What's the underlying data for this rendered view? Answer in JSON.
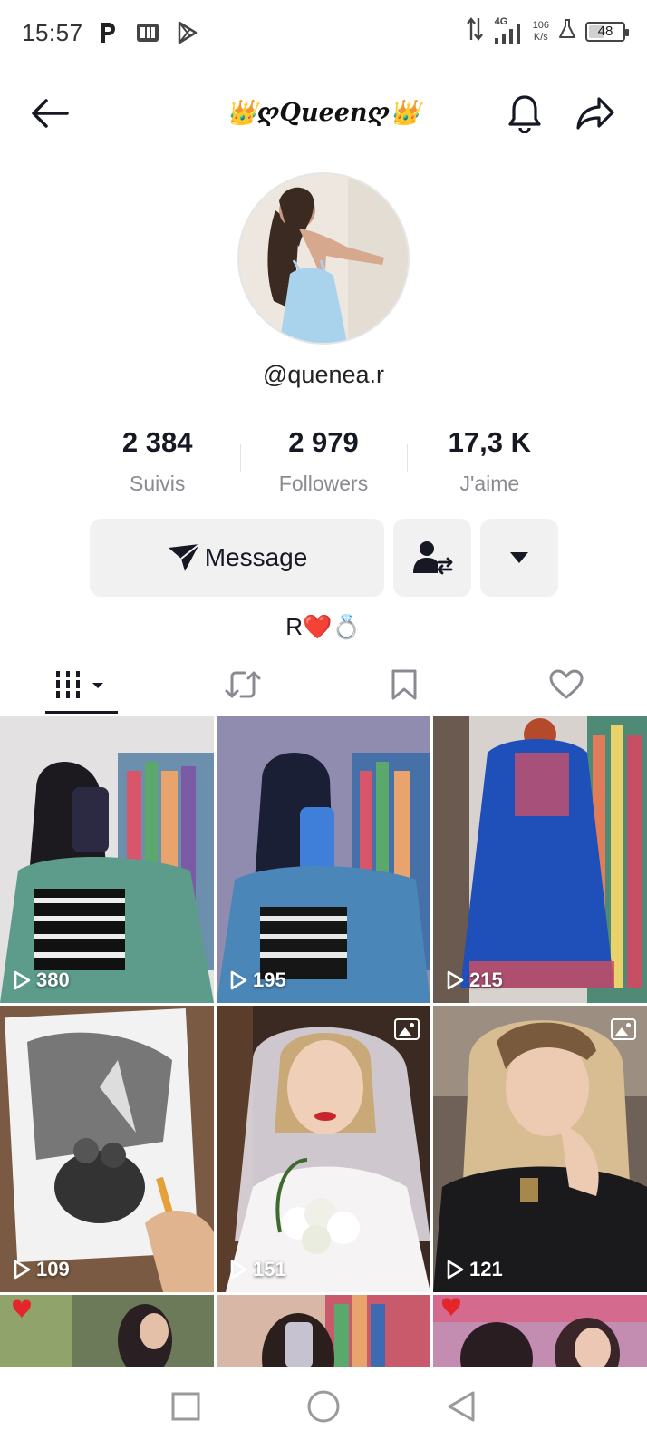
{
  "status_bar": {
    "time": "15:57",
    "network": "4G",
    "speed_value": "106",
    "speed_unit": "K/s",
    "battery": "48",
    "battery_level": 0.48
  },
  "header": {
    "title": "👑ღQueenღ👑"
  },
  "profile": {
    "username": "@quenea.r",
    "bio": "R❤️💍"
  },
  "stats": [
    {
      "value": "2 384",
      "label": "Suivis"
    },
    {
      "value": "2 979",
      "label": "Followers"
    },
    {
      "value": "17,3 K",
      "label": "J'aime"
    }
  ],
  "actions": {
    "message_label": "Message"
  },
  "tabs": [
    {
      "name": "videos-grid-icon",
      "active": true
    },
    {
      "name": "reposts-icon",
      "active": false
    },
    {
      "name": "bookmark-icon",
      "active": false
    },
    {
      "name": "liked-icon",
      "active": false
    }
  ],
  "grid": {
    "items": [
      {
        "views": "380",
        "type": "video"
      },
      {
        "views": "195",
        "type": "video"
      },
      {
        "views": "215",
        "type": "video"
      },
      {
        "views": "109",
        "type": "video"
      },
      {
        "views": "151",
        "type": "photo"
      },
      {
        "views": "121",
        "type": "photo"
      }
    ]
  },
  "colors": {
    "text": "#161823",
    "secondary": "#8a8b91",
    "button_bg": "#f1f1f2",
    "accent_red": "#fe2c55"
  }
}
